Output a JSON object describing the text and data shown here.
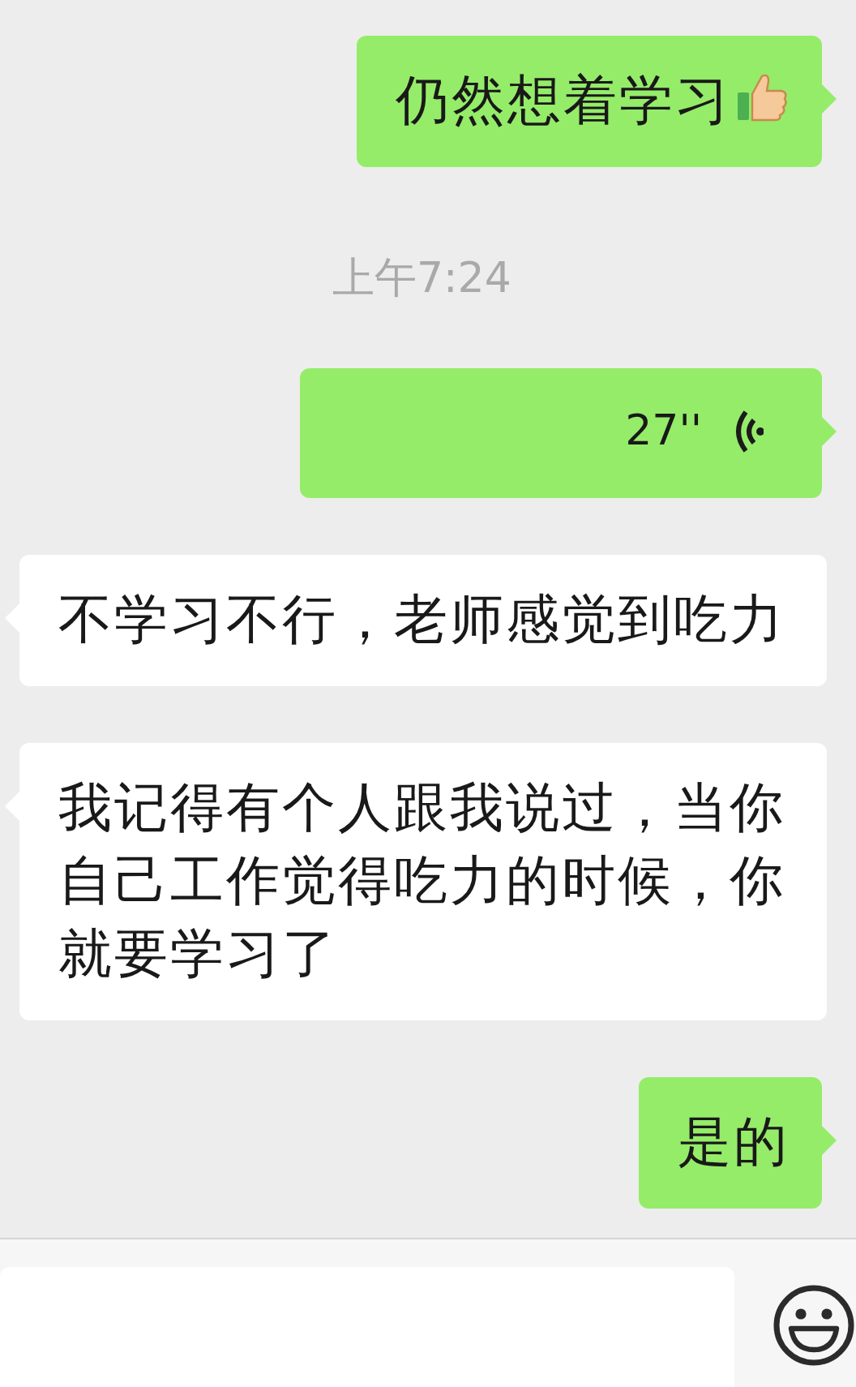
{
  "messages": [
    {
      "kind": "text",
      "outgoing": true,
      "text": "仍然想着学习",
      "thumbs_up": true
    },
    {
      "kind": "time",
      "text": "上午7:24"
    },
    {
      "kind": "voice",
      "outgoing": true,
      "duration": "27''"
    },
    {
      "kind": "text",
      "outgoing": false,
      "text": "不学习不行，老师感觉到吃力"
    },
    {
      "kind": "text",
      "outgoing": false,
      "text": "我记得有个人跟我说过，当你自己工作觉得吃力的时候，你就要学习了"
    },
    {
      "kind": "text",
      "outgoing": true,
      "text": "是的"
    }
  ]
}
